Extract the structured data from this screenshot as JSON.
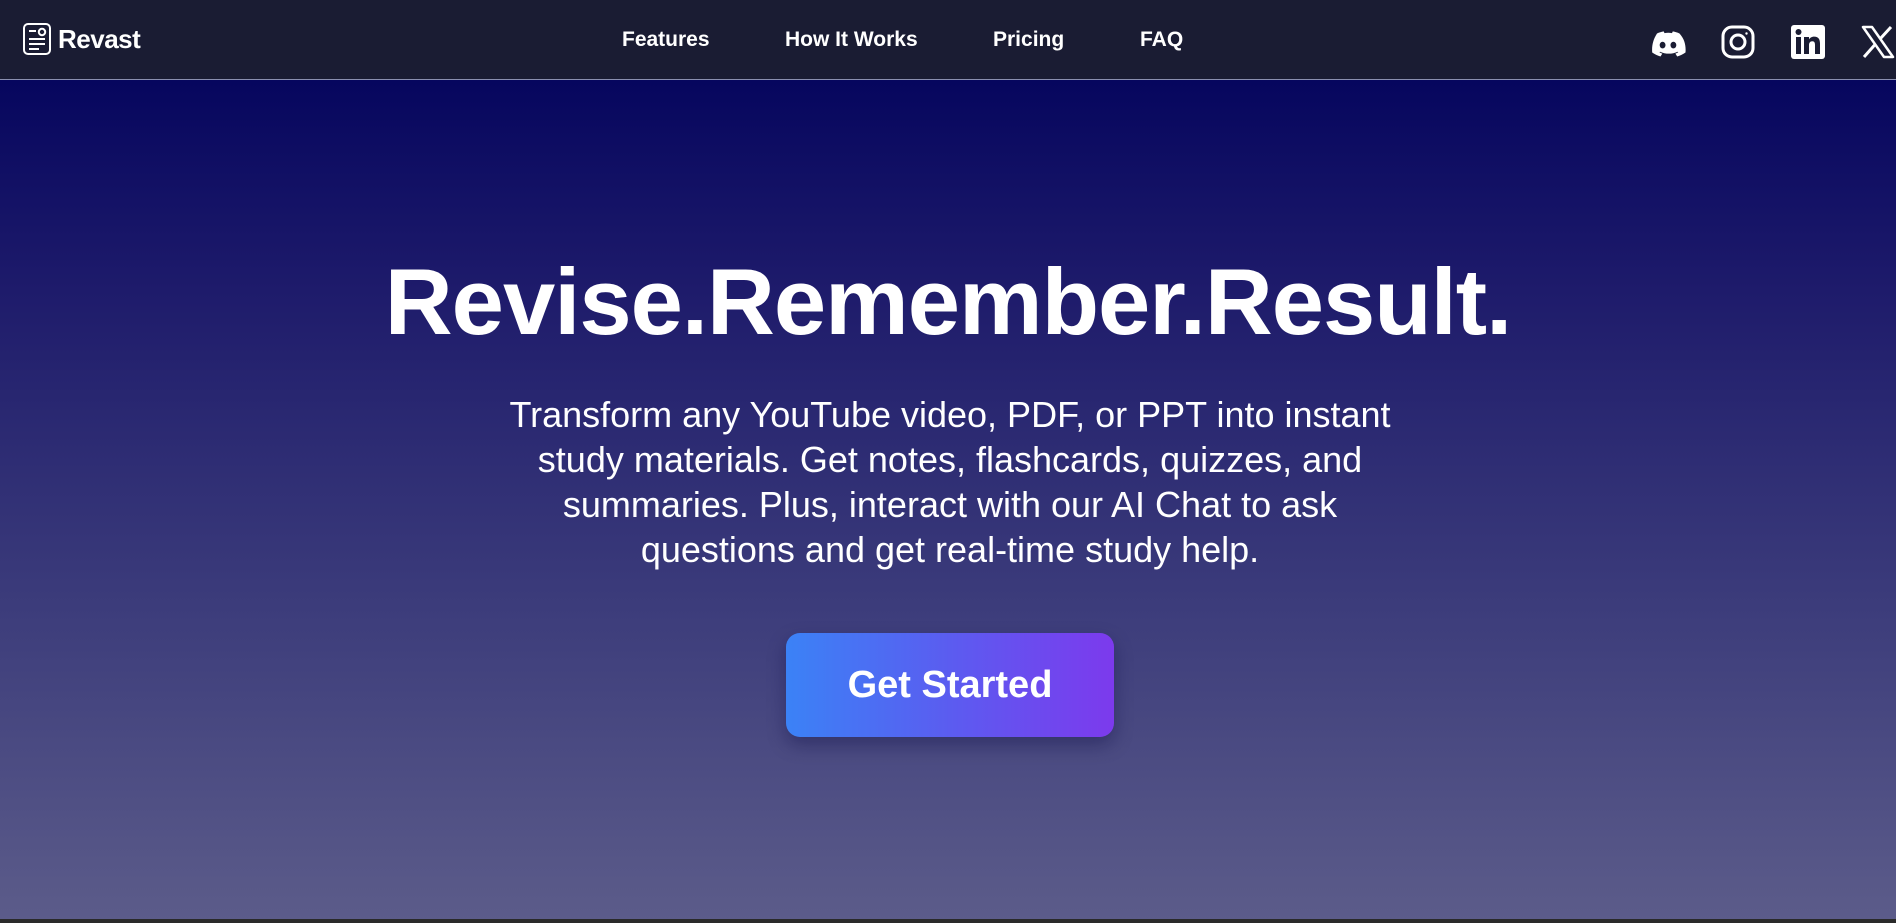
{
  "brand": {
    "name": "Revast",
    "icon": "document-notes-icon"
  },
  "nav": {
    "links": [
      {
        "label": "Features"
      },
      {
        "label": "How It Works"
      },
      {
        "label": "Pricing"
      },
      {
        "label": "FAQ"
      }
    ]
  },
  "social": [
    {
      "icon": "discord-icon"
    },
    {
      "icon": "instagram-icon"
    },
    {
      "icon": "linkedin-icon"
    },
    {
      "icon": "x-icon"
    }
  ],
  "hero": {
    "title": "Revise.Remember.Result.",
    "subtitle": "Transform any YouTube video, PDF, or PPT into instant study materials. Get notes, flashcards, quizzes, and summaries. Plus, interact with our AI Chat to ask questions and get real-time study help.",
    "cta_label": "Get Started"
  },
  "colors": {
    "navbar_bg": "#1a1c33",
    "hero_gradient_top": "#06065e",
    "hero_gradient_bottom": "#5c5c8a",
    "cta_gradient_start": "#3b82f6",
    "cta_gradient_end": "#7c3aed",
    "text": "#ffffff"
  }
}
